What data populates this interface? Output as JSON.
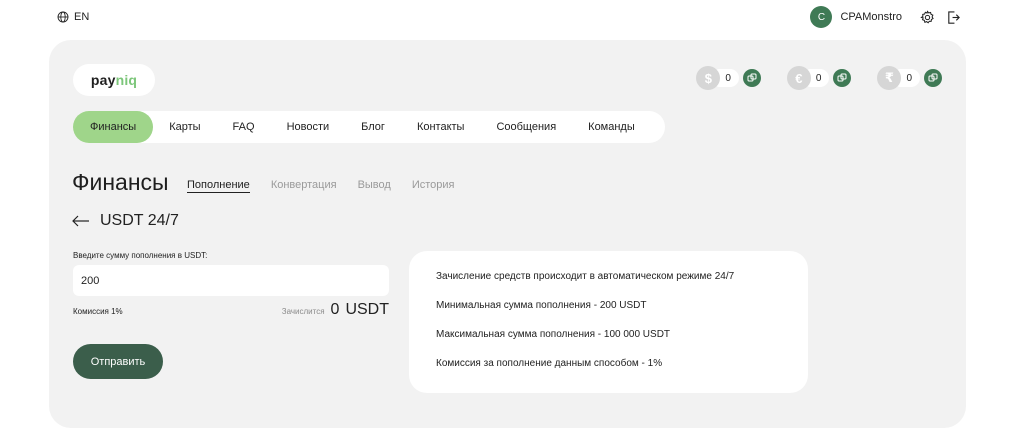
{
  "topbar": {
    "language": "EN",
    "avatar_letter": "C",
    "username": "CPAMonstro"
  },
  "logo": {
    "part1": "pay",
    "part2": "niq"
  },
  "balances": [
    {
      "symbol": "$",
      "value": "0",
      "icon": "dollar-coin-icon"
    },
    {
      "symbol": "€",
      "value": "0",
      "icon": "euro-coin-icon"
    },
    {
      "symbol": "₹",
      "value": "0",
      "icon": "rupee-coin-icon"
    }
  ],
  "nav": {
    "items": [
      "Финансы",
      "Карты",
      "FAQ",
      "Новости",
      "Блог",
      "Контакты",
      "Сообщения",
      "Команды"
    ],
    "active_index": 0
  },
  "page": {
    "title": "Финансы",
    "subtabs": [
      "Пополнение",
      "Конвертация",
      "Вывод",
      "История"
    ],
    "active_subtab": 0
  },
  "method": {
    "title": "USDT 24/7"
  },
  "form": {
    "amount_label": "Введите сумму пополнения в USDT:",
    "amount_value": "200",
    "commission": "Комиссия 1%",
    "credited_label": "Зачислится",
    "credited_value": "0",
    "credited_currency": "USDT",
    "submit_label": "Отправить"
  },
  "info": {
    "lines": [
      "Зачисление средств происходит в автоматическом режиме 24/7",
      "Минимальная сумма пополнения - 200 USDT",
      "Максимальная сумма пополнения - 100 000 USDT",
      "Комиссия за пополнение данным способом - 1%"
    ]
  },
  "colors": {
    "accent_green": "#9fd58a",
    "dark_green": "#3b5e4b",
    "panel_bg": "#f2f2f2"
  }
}
